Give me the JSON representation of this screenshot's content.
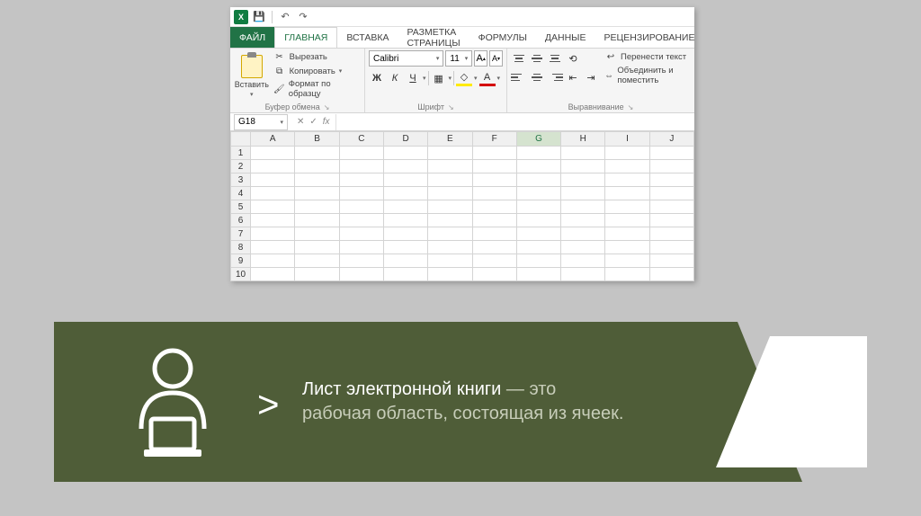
{
  "titlebar": {
    "logo": "X",
    "save_icon": "💾",
    "undo_icon": "↶",
    "redo_icon": "↷"
  },
  "tabs": {
    "file": "ФАЙЛ",
    "home": "ГЛАВНАЯ",
    "insert": "ВСТАВКА",
    "layout": "РАЗМЕТКА СТРАНИЦЫ",
    "formulas": "ФОРМУЛЫ",
    "data": "ДАННЫЕ",
    "review": "РЕЦЕНЗИРОВАНИЕ"
  },
  "ribbon": {
    "clipboard": {
      "paste": "Вставить",
      "cut": "Вырезать",
      "copy": "Копировать",
      "format_painter": "Формат по образцу",
      "group_label": "Буфер обмена"
    },
    "font": {
      "name": "Calibri",
      "size": "11",
      "increase": "A",
      "decrease": "A",
      "bold": "Ж",
      "italic": "К",
      "underline": "Ч",
      "group_label": "Шрифт"
    },
    "alignment": {
      "wrap": "Перенести текст",
      "merge": "Объединить и поместить",
      "group_label": "Выравнивание"
    }
  },
  "namebox": {
    "value": "G18",
    "fx": "fx"
  },
  "grid": {
    "columns": [
      "A",
      "B",
      "C",
      "D",
      "E",
      "F",
      "G",
      "H",
      "I",
      "J"
    ],
    "selected_col": "G",
    "rows": [
      "1",
      "2",
      "3",
      "4",
      "5",
      "6",
      "7",
      "8",
      "9",
      "10"
    ]
  },
  "banner": {
    "chevron": ">",
    "bold": "Лист электронной книги",
    "rest1": " — это",
    "line2": "рабочая область, состоящая из ячеек."
  }
}
